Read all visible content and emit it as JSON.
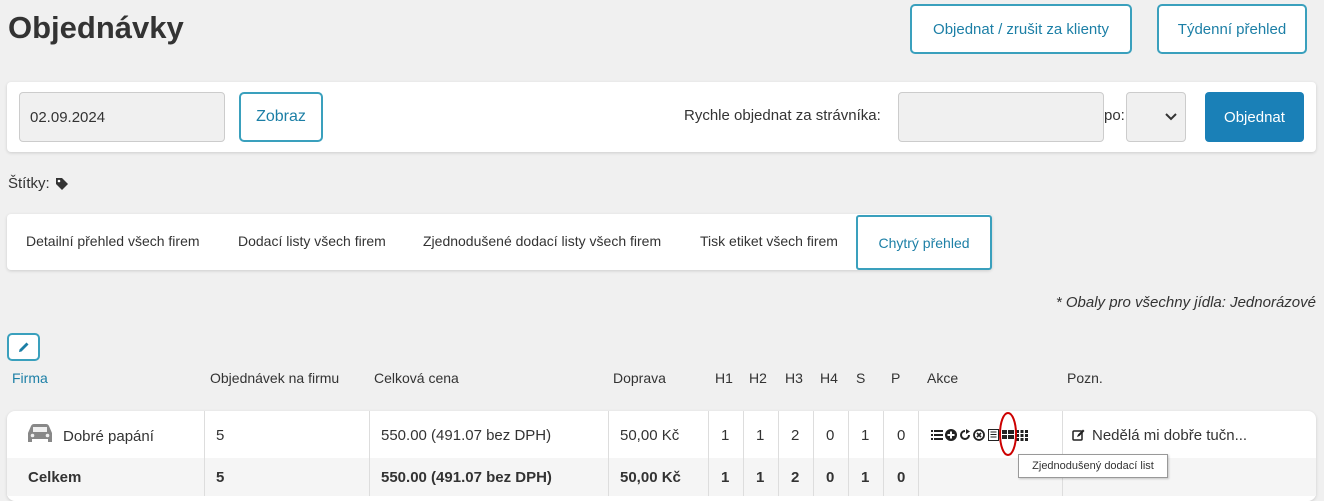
{
  "page": {
    "title": "Objednávky"
  },
  "header_buttons": {
    "order_cancel": "Objednat / zrušit za klienty",
    "weekly": "Týdenní přehled"
  },
  "filter": {
    "date_value": "02.09.2024",
    "show_label": "Zobraz",
    "quick_order_label": "Rychle objednat za strávníka:",
    "quick_order_value": "",
    "po_label": "po:",
    "po_value": "",
    "order_label": "Objednat"
  },
  "tags": {
    "label": "Štítky:"
  },
  "tabs": [
    {
      "label": "Detailní přehled všech firem"
    },
    {
      "label": "Dodací listy všech firem"
    },
    {
      "label": "Zjednodušené dodací listy všech firem"
    },
    {
      "label": "Tisk etiket všech firem"
    },
    {
      "label": "Chytrý přehled",
      "active": true
    }
  ],
  "note": "* Obaly pro všechny jídla: Jednorázové",
  "table": {
    "headers": {
      "firma": "Firma",
      "orders": "Objednávek na firmu",
      "price": "Celková cena",
      "transport": "Doprava",
      "h1": "H1",
      "h2": "H2",
      "h3": "H3",
      "h4": "H4",
      "s": "S",
      "p": "P",
      "actions": "Akce",
      "note": "Pozn."
    },
    "rows": [
      {
        "firma": "Dobré papání",
        "orders": "5",
        "price": "550.00 (491.07 bez DPH)",
        "transport": "50,00 Kč",
        "h1": "1",
        "h2": "1",
        "h3": "2",
        "h4": "0",
        "s": "1",
        "p": "0",
        "note": "Nedělá mi dobře tučn..."
      }
    ],
    "total": {
      "label": "Celkem",
      "orders": "5",
      "price": "550.00 (491.07 bez DPH)",
      "transport": "50,00 Kč",
      "h1": "1",
      "h2": "1",
      "h3": "2",
      "h4": "0",
      "s": "1",
      "p": "0"
    }
  },
  "tooltip": "Zjednodušený dodací list",
  "colors": {
    "accent": "#3aa0bd",
    "primary": "#1a80b7",
    "highlight_ring": "#cc0000"
  }
}
